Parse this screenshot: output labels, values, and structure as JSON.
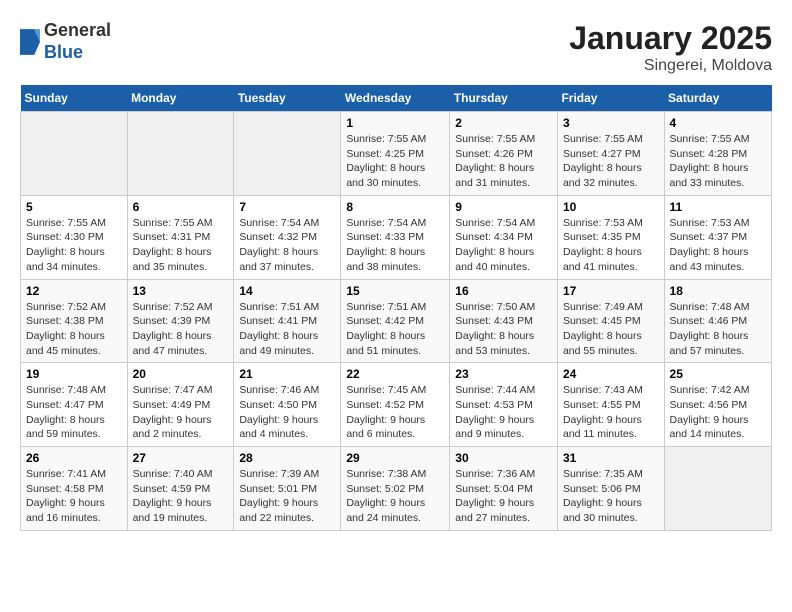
{
  "header": {
    "logo_general": "General",
    "logo_blue": "Blue",
    "title": "January 2025",
    "subtitle": "Singerei, Moldova"
  },
  "weekdays": [
    "Sunday",
    "Monday",
    "Tuesday",
    "Wednesday",
    "Thursday",
    "Friday",
    "Saturday"
  ],
  "weeks": [
    [
      {
        "day": "",
        "info": ""
      },
      {
        "day": "",
        "info": ""
      },
      {
        "day": "",
        "info": ""
      },
      {
        "day": "1",
        "info": "Sunrise: 7:55 AM\nSunset: 4:25 PM\nDaylight: 8 hours\nand 30 minutes."
      },
      {
        "day": "2",
        "info": "Sunrise: 7:55 AM\nSunset: 4:26 PM\nDaylight: 8 hours\nand 31 minutes."
      },
      {
        "day": "3",
        "info": "Sunrise: 7:55 AM\nSunset: 4:27 PM\nDaylight: 8 hours\nand 32 minutes."
      },
      {
        "day": "4",
        "info": "Sunrise: 7:55 AM\nSunset: 4:28 PM\nDaylight: 8 hours\nand 33 minutes."
      }
    ],
    [
      {
        "day": "5",
        "info": "Sunrise: 7:55 AM\nSunset: 4:30 PM\nDaylight: 8 hours\nand 34 minutes."
      },
      {
        "day": "6",
        "info": "Sunrise: 7:55 AM\nSunset: 4:31 PM\nDaylight: 8 hours\nand 35 minutes."
      },
      {
        "day": "7",
        "info": "Sunrise: 7:54 AM\nSunset: 4:32 PM\nDaylight: 8 hours\nand 37 minutes."
      },
      {
        "day": "8",
        "info": "Sunrise: 7:54 AM\nSunset: 4:33 PM\nDaylight: 8 hours\nand 38 minutes."
      },
      {
        "day": "9",
        "info": "Sunrise: 7:54 AM\nSunset: 4:34 PM\nDaylight: 8 hours\nand 40 minutes."
      },
      {
        "day": "10",
        "info": "Sunrise: 7:53 AM\nSunset: 4:35 PM\nDaylight: 8 hours\nand 41 minutes."
      },
      {
        "day": "11",
        "info": "Sunrise: 7:53 AM\nSunset: 4:37 PM\nDaylight: 8 hours\nand 43 minutes."
      }
    ],
    [
      {
        "day": "12",
        "info": "Sunrise: 7:52 AM\nSunset: 4:38 PM\nDaylight: 8 hours\nand 45 minutes."
      },
      {
        "day": "13",
        "info": "Sunrise: 7:52 AM\nSunset: 4:39 PM\nDaylight: 8 hours\nand 47 minutes."
      },
      {
        "day": "14",
        "info": "Sunrise: 7:51 AM\nSunset: 4:41 PM\nDaylight: 8 hours\nand 49 minutes."
      },
      {
        "day": "15",
        "info": "Sunrise: 7:51 AM\nSunset: 4:42 PM\nDaylight: 8 hours\nand 51 minutes."
      },
      {
        "day": "16",
        "info": "Sunrise: 7:50 AM\nSunset: 4:43 PM\nDaylight: 8 hours\nand 53 minutes."
      },
      {
        "day": "17",
        "info": "Sunrise: 7:49 AM\nSunset: 4:45 PM\nDaylight: 8 hours\nand 55 minutes."
      },
      {
        "day": "18",
        "info": "Sunrise: 7:48 AM\nSunset: 4:46 PM\nDaylight: 8 hours\nand 57 minutes."
      }
    ],
    [
      {
        "day": "19",
        "info": "Sunrise: 7:48 AM\nSunset: 4:47 PM\nDaylight: 8 hours\nand 59 minutes."
      },
      {
        "day": "20",
        "info": "Sunrise: 7:47 AM\nSunset: 4:49 PM\nDaylight: 9 hours\nand 2 minutes."
      },
      {
        "day": "21",
        "info": "Sunrise: 7:46 AM\nSunset: 4:50 PM\nDaylight: 9 hours\nand 4 minutes."
      },
      {
        "day": "22",
        "info": "Sunrise: 7:45 AM\nSunset: 4:52 PM\nDaylight: 9 hours\nand 6 minutes."
      },
      {
        "day": "23",
        "info": "Sunrise: 7:44 AM\nSunset: 4:53 PM\nDaylight: 9 hours\nand 9 minutes."
      },
      {
        "day": "24",
        "info": "Sunrise: 7:43 AM\nSunset: 4:55 PM\nDaylight: 9 hours\nand 11 minutes."
      },
      {
        "day": "25",
        "info": "Sunrise: 7:42 AM\nSunset: 4:56 PM\nDaylight: 9 hours\nand 14 minutes."
      }
    ],
    [
      {
        "day": "26",
        "info": "Sunrise: 7:41 AM\nSunset: 4:58 PM\nDaylight: 9 hours\nand 16 minutes."
      },
      {
        "day": "27",
        "info": "Sunrise: 7:40 AM\nSunset: 4:59 PM\nDaylight: 9 hours\nand 19 minutes."
      },
      {
        "day": "28",
        "info": "Sunrise: 7:39 AM\nSunset: 5:01 PM\nDaylight: 9 hours\nand 22 minutes."
      },
      {
        "day": "29",
        "info": "Sunrise: 7:38 AM\nSunset: 5:02 PM\nDaylight: 9 hours\nand 24 minutes."
      },
      {
        "day": "30",
        "info": "Sunrise: 7:36 AM\nSunset: 5:04 PM\nDaylight: 9 hours\nand 27 minutes."
      },
      {
        "day": "31",
        "info": "Sunrise: 7:35 AM\nSunset: 5:06 PM\nDaylight: 9 hours\nand 30 minutes."
      },
      {
        "day": "",
        "info": ""
      }
    ]
  ]
}
